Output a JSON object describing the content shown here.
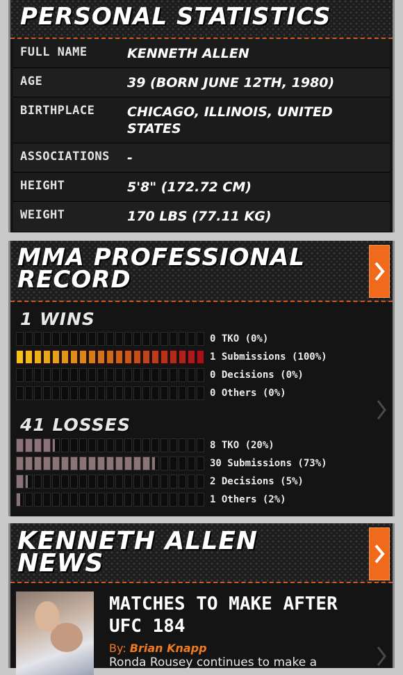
{
  "personal": {
    "title": "PERSONAL STATISTICS",
    "rows": [
      {
        "label": "FULL NAME",
        "value": "KENNETH ALLEN"
      },
      {
        "label": "AGE",
        "value": "39 (BORN JUNE 12TH, 1980)"
      },
      {
        "label": "BIRTHPLACE",
        "value": "CHICAGO, ILLINOIS, UNITED STATES"
      },
      {
        "label": "ASSOCIATIONS",
        "value": "-"
      },
      {
        "label": "HEIGHT",
        "value": "5'8\" (172.72 CM)"
      },
      {
        "label": "WEIGHT",
        "value": "170 LBS (77.11 KG)"
      }
    ]
  },
  "record": {
    "title": "MMA PROFESSIONAL\nRECORD",
    "arrow_icon": "chevron-right-icon",
    "wins": {
      "heading": "1 WINS",
      "rows": [
        {
          "label": "0 TKO (0%)",
          "percent": 0
        },
        {
          "label": "1 Submissions (100%)",
          "percent": 100
        },
        {
          "label": "0 Decisions (0%)",
          "percent": 0
        },
        {
          "label": "0 Others (0%)",
          "percent": 0
        }
      ]
    },
    "losses": {
      "heading": "41 LOSSES",
      "rows": [
        {
          "label": "8 TKO (20%)",
          "percent": 20
        },
        {
          "label": "30 Submissions (73%)",
          "percent": 73
        },
        {
          "label": "2 Decisions (5%)",
          "percent": 5
        },
        {
          "label": "1 Others (2%)",
          "percent": 2
        }
      ]
    }
  },
  "news": {
    "title": "KENNETH ALLEN\nNEWS",
    "arrow_icon": "chevron-right-icon",
    "item": {
      "headline": "MATCHES TO MAKE AFTER UFC 184",
      "by_prefix": "By:",
      "author": "Brian Knapp",
      "snippet": "Ronda Rousey continues to make a"
    }
  },
  "colors": {
    "accent_orange": "#f06a1c",
    "wins_gradient_start": "#f2c418",
    "wins_gradient_end": "#a8101c",
    "loss_fill": "#8a7478"
  }
}
